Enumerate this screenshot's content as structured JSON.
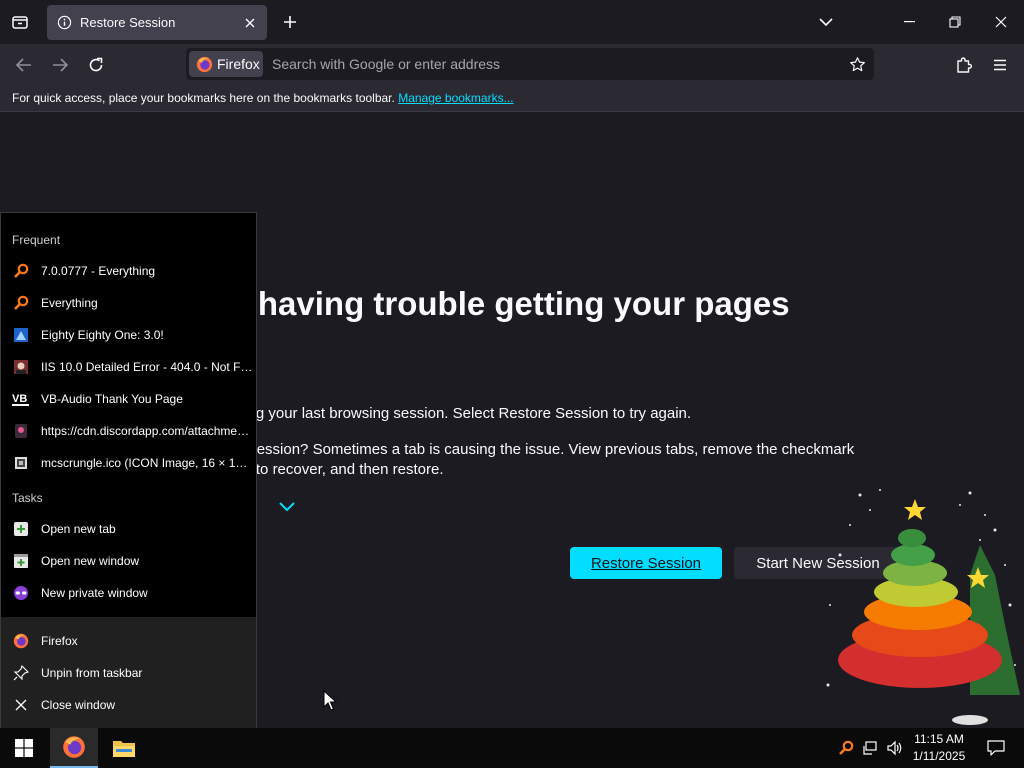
{
  "browser": {
    "active_tab_title": "Restore Session",
    "url_identity_label": "Firefox",
    "url_placeholder": "Search with Google or enter address"
  },
  "bookmarks_bar": {
    "message": "For quick access, place your bookmarks here on the bookmarks toolbar.",
    "link_label": "Manage bookmarks..."
  },
  "page": {
    "title": "e’re having trouble getting your pages",
    "description": "le restoring your last browsing session. Select Restore Session to try again.",
    "hint_line1": "ore your session? Sometimes a tab is causing the issue. View previous tabs, remove the checkmark",
    "hint_line2": "on’t need to recover, and then restore.",
    "restore_button": "Restore Session",
    "new_session_button": "Start New Session"
  },
  "jumplist": {
    "frequent_header": "Frequent",
    "frequent_items": [
      {
        "label": "7.0.0777 - Everything",
        "icon": "everything-icon"
      },
      {
        "label": "Everything",
        "icon": "everything-icon"
      },
      {
        "label": "Eighty Eighty One: 3.0!",
        "icon": "site-icon"
      },
      {
        "label": "IIS 10.0 Detailed Error - 404.0 - Not Fo...",
        "icon": "site-icon"
      },
      {
        "label": "VB-Audio Thank You Page",
        "icon": "vb-audio-icon"
      },
      {
        "label": "https://cdn.discordapp.com/attachmen...",
        "icon": "site-icon"
      },
      {
        "label": "mcscrungle.ico (ICON Image, 16 × 16 p...",
        "icon": "image-icon"
      }
    ],
    "tasks_header": "Tasks",
    "task_items": [
      {
        "label": "Open new tab",
        "icon": "new-tab-icon"
      },
      {
        "label": "Open new window",
        "icon": "new-window-icon"
      },
      {
        "label": "New private window",
        "icon": "private-window-icon"
      }
    ],
    "app_items": [
      {
        "label": "Firefox",
        "icon": "firefox-icon"
      },
      {
        "label": "Unpin from taskbar",
        "icon": "unpin-icon"
      },
      {
        "label": "Close window",
        "icon": "close-icon"
      }
    ]
  },
  "taskbar": {
    "time": "11:15 AM",
    "date": "1/11/2025"
  },
  "colors": {
    "accent": "#00ddff",
    "tab_bg": "#1c1b22",
    "toolbar_bg": "#2b2a33"
  }
}
